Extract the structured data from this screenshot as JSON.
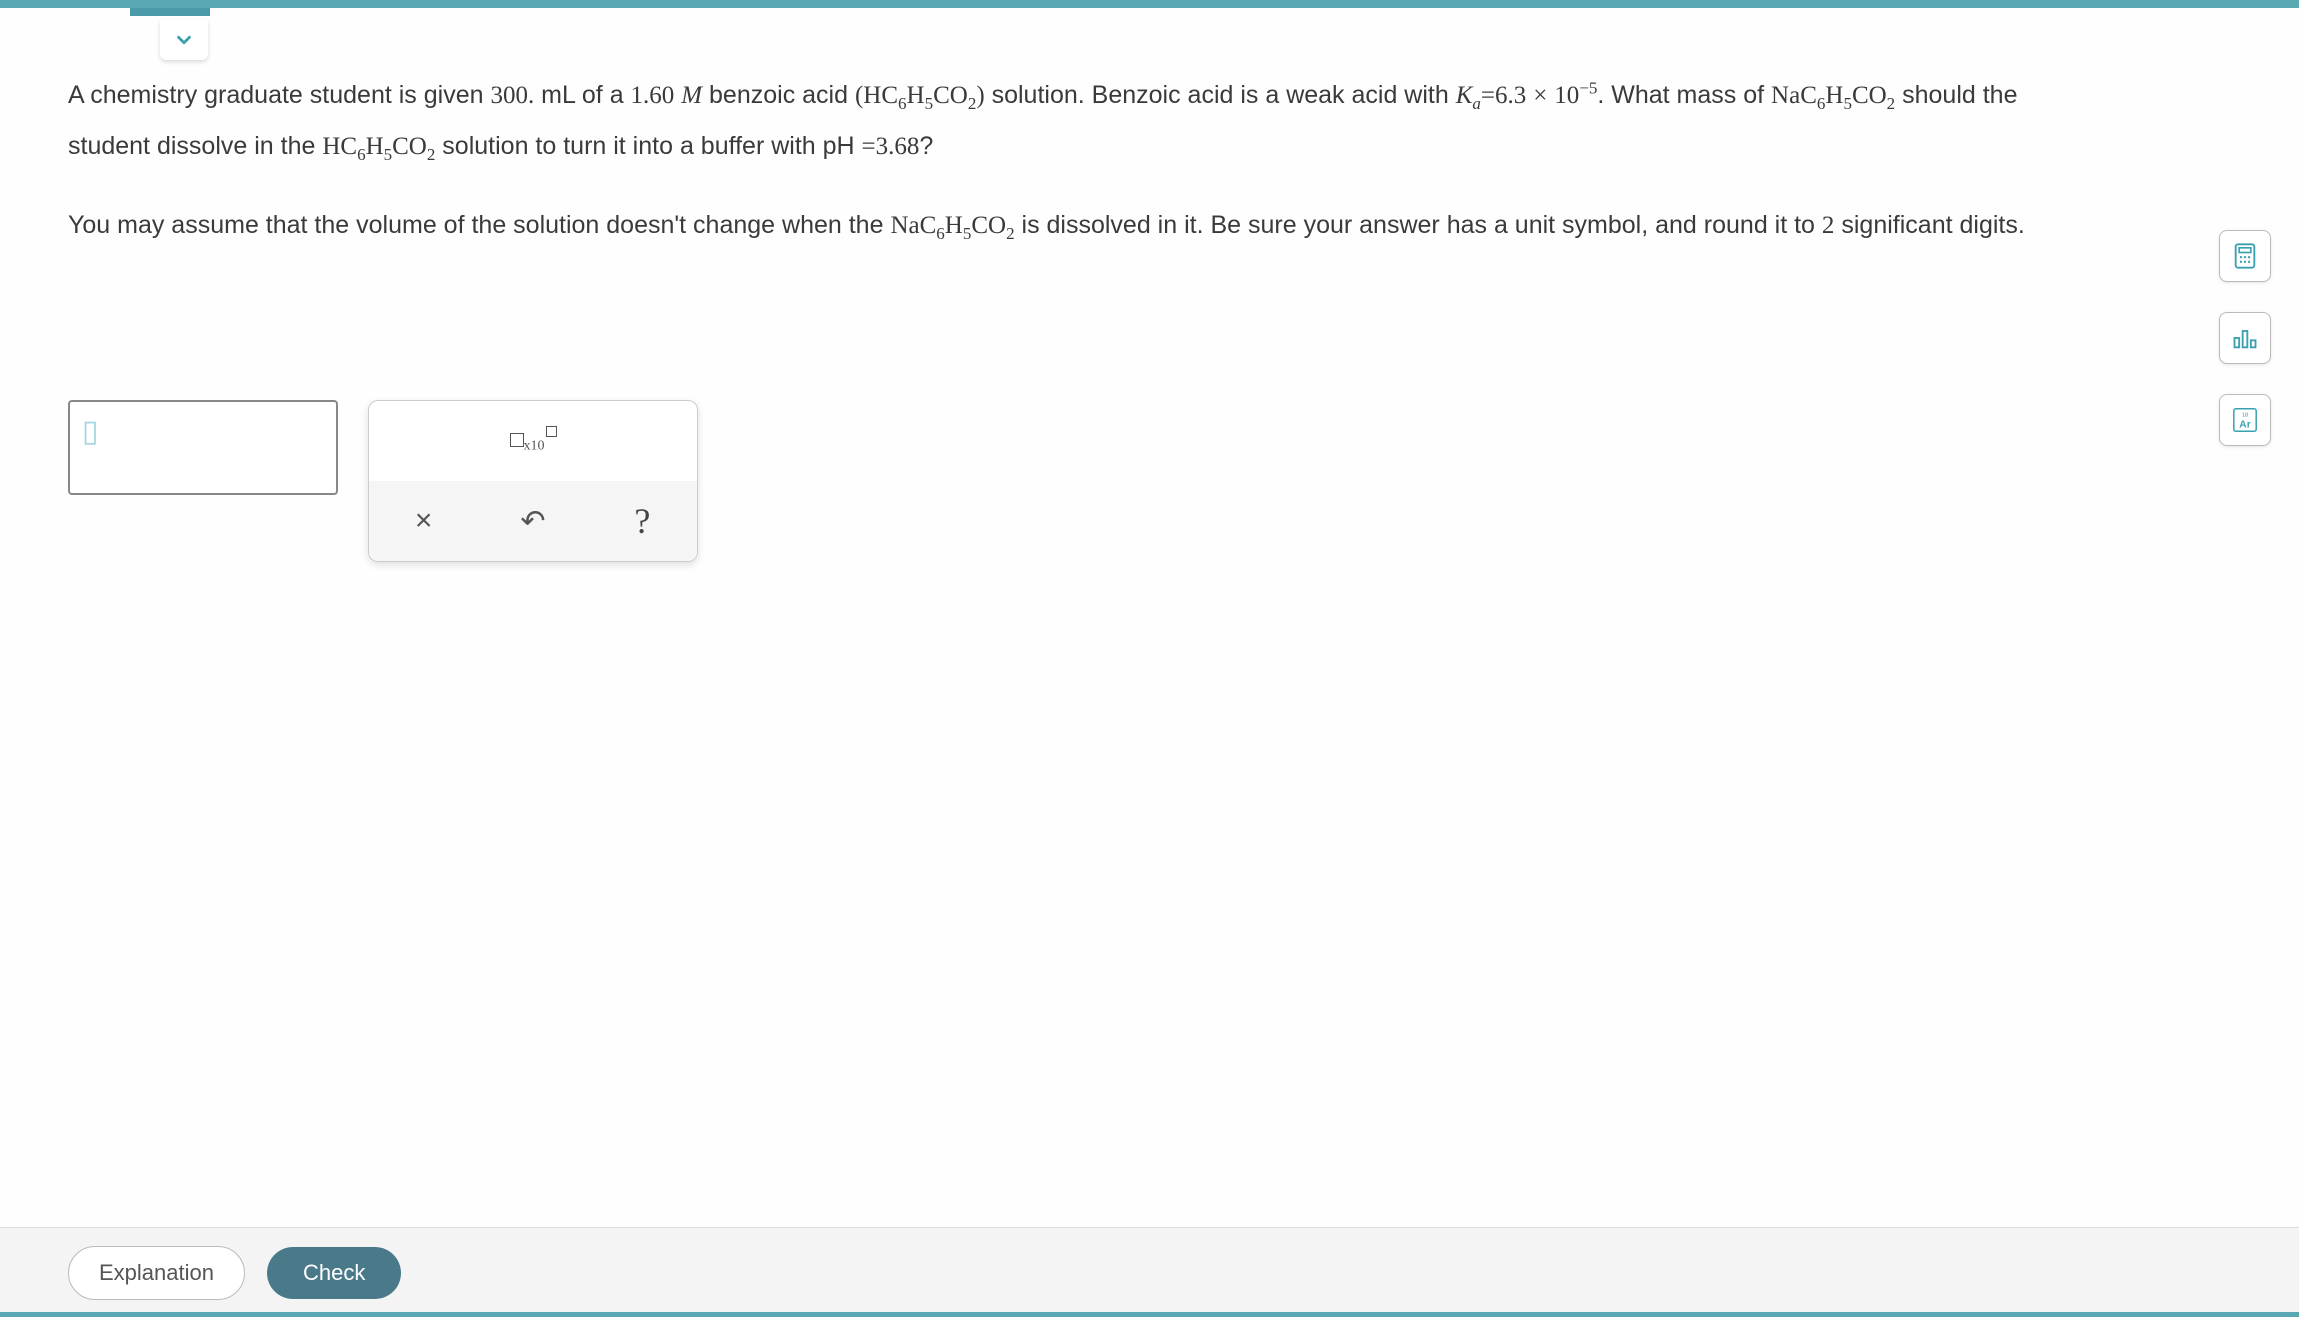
{
  "question": {
    "p1_a": "A chemistry graduate student is given ",
    "vol": "300.",
    "p1_b": " mL of a ",
    "conc": "1.60",
    "p1_c": " benzoic acid ",
    "p1_d": " solution. Benzoic acid is a weak acid with ",
    "ka_val": "6.3",
    "ka_exp": "−5",
    "p1_e": ". What mass of ",
    "p1_f": " should the student dissolve in the ",
    "p1_g": " solution to turn it into a buffer with pH ",
    "ph_val": "3.68",
    "p1_h": "?",
    "p2_a": "You may assume that the volume of the solution doesn't change when the ",
    "p2_b": " is dissolved in it. Be sure your answer has a unit symbol, and round it to ",
    "sigfigs": "2",
    "p2_c": " significant digits."
  },
  "formulas": {
    "acid_open": "(",
    "acid_HC": "HC",
    "acid_H": "H",
    "acid_CO": "CO",
    "acid_close": ")",
    "salt_Na": "NaC",
    "M": "M",
    "Ka_K": "K",
    "Ka_a": "a",
    "eq": "=",
    "times": "×",
    "ten": "10",
    "sub6": "6",
    "sub5": "5",
    "sub2": "2"
  },
  "toolbox": {
    "x10_label": "x10",
    "clear": "×",
    "undo": "↶",
    "help": "?"
  },
  "sidebar": {
    "calculator": "calculator-icon",
    "stats": "bar-chart-icon",
    "periodic": "Ar",
    "periodic_num": "18"
  },
  "footer": {
    "explanation": "Explanation",
    "check": "Check"
  },
  "answer_placeholder": "▯"
}
